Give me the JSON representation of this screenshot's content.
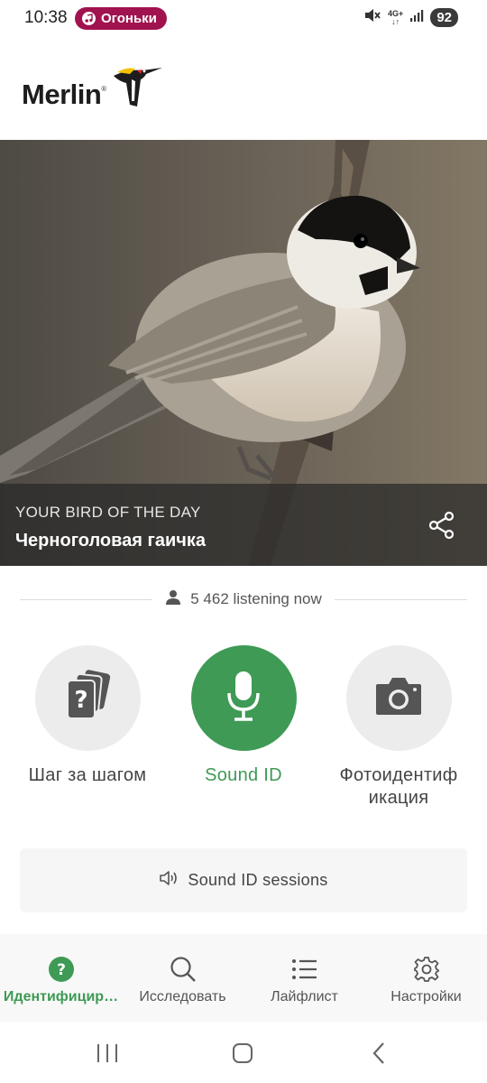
{
  "status_bar": {
    "time": "10:38",
    "music_pill": "Огоньки",
    "network_top": "4G+",
    "network_bottom": "↓↑",
    "battery": "92"
  },
  "header": {
    "logo_text": "Merlin",
    "logo_mark": "®"
  },
  "hero": {
    "kicker": "YOUR BIRD OF THE DAY",
    "bird_name": "Черноголовая гаичка"
  },
  "listening": {
    "text": "5 462 listening now"
  },
  "id_options": [
    {
      "label": "Шаг за шагом",
      "icon": "question-cards-icon"
    },
    {
      "label": "Sound ID",
      "icon": "microphone-icon"
    },
    {
      "label_line1": "Фотоидентиф",
      "label_line2": "икация",
      "icon": "camera-icon"
    }
  ],
  "sessions": {
    "label": "Sound ID sessions"
  },
  "bottom_nav": [
    {
      "label": "Идентифицир…",
      "icon": "question-circle-icon",
      "active": true
    },
    {
      "label": "Исследовать",
      "icon": "search-icon"
    },
    {
      "label": "Лайфлист",
      "icon": "list-icon"
    },
    {
      "label": "Настройки",
      "icon": "gear-icon"
    }
  ],
  "colors": {
    "accent_green": "#3e9a55",
    "pill_magenta": "#a0134f",
    "caption_overlay": "#282828"
  }
}
